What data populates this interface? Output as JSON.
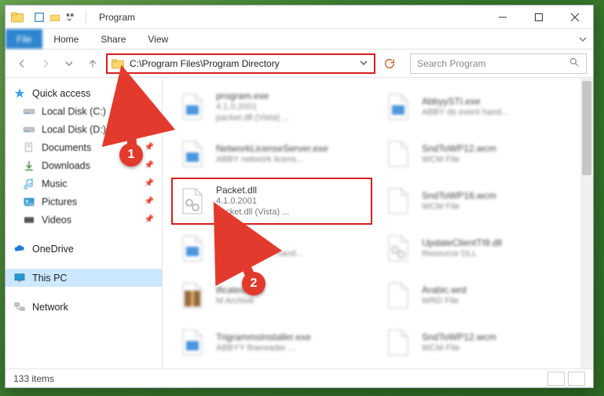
{
  "titlebar": {
    "app_title": "Program"
  },
  "ribbon": {
    "file": "File",
    "tabs": [
      "Home",
      "Share",
      "View"
    ]
  },
  "nav": {
    "path": "C:\\Program Files\\Program Directory",
    "search_placeholder": "Search Program"
  },
  "sidebar": {
    "quick_access": {
      "label": "Quick access"
    },
    "items": [
      {
        "label": "Local Disk (C:)"
      },
      {
        "label": "Local Disk (D:)"
      },
      {
        "label": "Documents"
      },
      {
        "label": "Downloads"
      },
      {
        "label": "Music"
      },
      {
        "label": "Pictures"
      },
      {
        "label": "Videos"
      }
    ],
    "onedrive": {
      "label": "OneDrive"
    },
    "thispc": {
      "label": "This PC"
    },
    "network": {
      "label": "Network"
    }
  },
  "files": {
    "col1": [
      {
        "l1": "program.exe",
        "l2": "4.1.0.2001",
        "l3": "packet.dll (Vista) ..."
      },
      {
        "l1": "NetworkLicenseServer.exe",
        "l2": "ABBY network licens..."
      },
      {
        "l1": "Packet.dll",
        "l2": "4.1.0.2001",
        "l3": "packet.dll (Vista) ..."
      },
      {
        "l1": "bbyySTI.exe",
        "l2": "ABBY ds event hand..."
      },
      {
        "l1": "ificates.cab",
        "l2": "M Archive"
      },
      {
        "l1": "TrigrammsInstaller.exe",
        "l2": "ABBYY finereader ..."
      }
    ],
    "col2": [
      {
        "l1": "AbbyySTI.exe",
        "l2": "ABBY ds event hand..."
      },
      {
        "l1": "SndToWP12.wcm",
        "l2": "WCM File"
      },
      {
        "l1": "SndToWP16.wcm",
        "l2": "WCM File"
      },
      {
        "l1": "UpdateClientTI9.dll",
        "l2": "Resource DLL"
      },
      {
        "l1": "Arabic.wrd",
        "l2": "WRD File"
      },
      {
        "l1": "SndToWP12.wcm",
        "l2": "WCM File"
      }
    ],
    "highlight_index": 2
  },
  "status": {
    "count_label": "133 items"
  },
  "annotations": {
    "marker1": "1",
    "marker2": "2"
  }
}
